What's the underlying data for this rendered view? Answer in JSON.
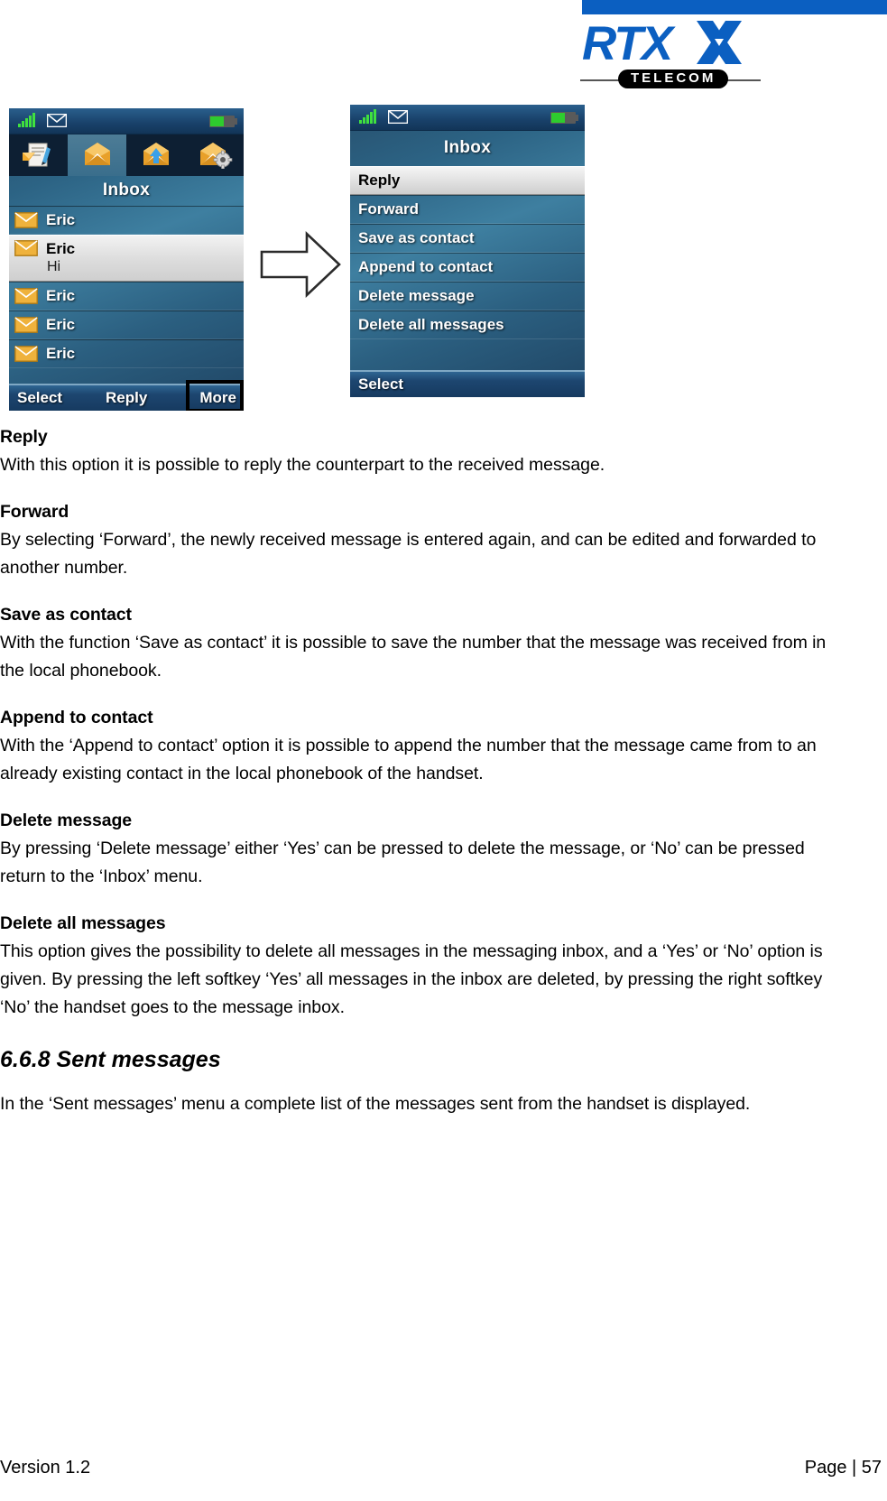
{
  "brand": {
    "name": "RTX",
    "sub": "TELECOM",
    "accent": "#0b5fc1"
  },
  "figure": {
    "left_phone": {
      "status": {
        "signal_bars": 5,
        "message_icon": "envelope-icon",
        "battery_icon": "battery-icon"
      },
      "tabs": [
        {
          "name": "write-message-tab",
          "icon": "compose-message-icon",
          "active": false
        },
        {
          "name": "inbox-tab",
          "icon": "open-envelope-icon",
          "active": true
        },
        {
          "name": "sent-messages-tab",
          "icon": "envelope-up-arrow-icon",
          "active": false
        },
        {
          "name": "message-settings-tab",
          "icon": "envelope-gear-icon",
          "active": false
        }
      ],
      "title": "Inbox",
      "rows": [
        {
          "sender": "Eric",
          "preview": "",
          "selected": false
        },
        {
          "sender": "Eric",
          "preview": "Hi",
          "selected": true
        },
        {
          "sender": "Eric",
          "preview": "",
          "selected": false
        },
        {
          "sender": "Eric",
          "preview": "",
          "selected": false
        },
        {
          "sender": "Eric",
          "preview": "",
          "selected": false
        }
      ],
      "softkeys": {
        "left": "Select",
        "center": "Reply",
        "right": "More",
        "highlighted": "More"
      }
    },
    "arrow": {
      "icon": "right-arrow-icon"
    },
    "right_phone": {
      "status": {
        "signal_bars": 5,
        "message_icon": "envelope-icon",
        "battery_icon": "battery-icon"
      },
      "title": "Inbox",
      "menu": [
        {
          "label": "Reply",
          "selected": true
        },
        {
          "label": "Forward",
          "selected": false
        },
        {
          "label": "Save as contact",
          "selected": false
        },
        {
          "label": "Append to contact",
          "selected": false
        },
        {
          "label": "Delete message",
          "selected": false
        },
        {
          "label": "Delete all messages",
          "selected": false
        }
      ],
      "softkeys": {
        "left": "Select"
      }
    }
  },
  "sections": [
    {
      "label": "Reply",
      "text": "With this option it is possible to reply the counterpart to the received message."
    },
    {
      "label": "Forward",
      "text": "By selecting ‘Forward’, the newly received message is entered again, and can be edited and forwarded to another number."
    },
    {
      "label": "Save as contact",
      "text": "With the function ‘Save as contact’ it is possible to save the number that the message was received from in the local phonebook."
    },
    {
      "label": "Append to contact",
      "text": "With the ‘Append to contact’ option it is possible to append the number that the message came from to an already existing contact in the local phonebook of the handset."
    },
    {
      "label": "Delete message",
      "text": "By pressing ‘Delete message’ either ‘Yes’ can be pressed to delete the message, or ‘No’ can be pressed return to the ‘Inbox’ menu."
    },
    {
      "label": "Delete all messages",
      "text": "This option gives the possibility to delete all messages in the messaging inbox, and a ‘Yes’ or ‘No’ option is given. By pressing the left softkey ‘Yes’ all messages in the inbox are deleted, by pressing the right softkey ‘No’ the handset goes to the message inbox."
    }
  ],
  "subsection": {
    "heading": "6.6.8 Sent messages",
    "text": "In the ‘Sent messages’ menu a complete list of the messages sent from the handset is displayed."
  },
  "footer": {
    "version": "Version 1.2",
    "page": "Page | 57"
  }
}
